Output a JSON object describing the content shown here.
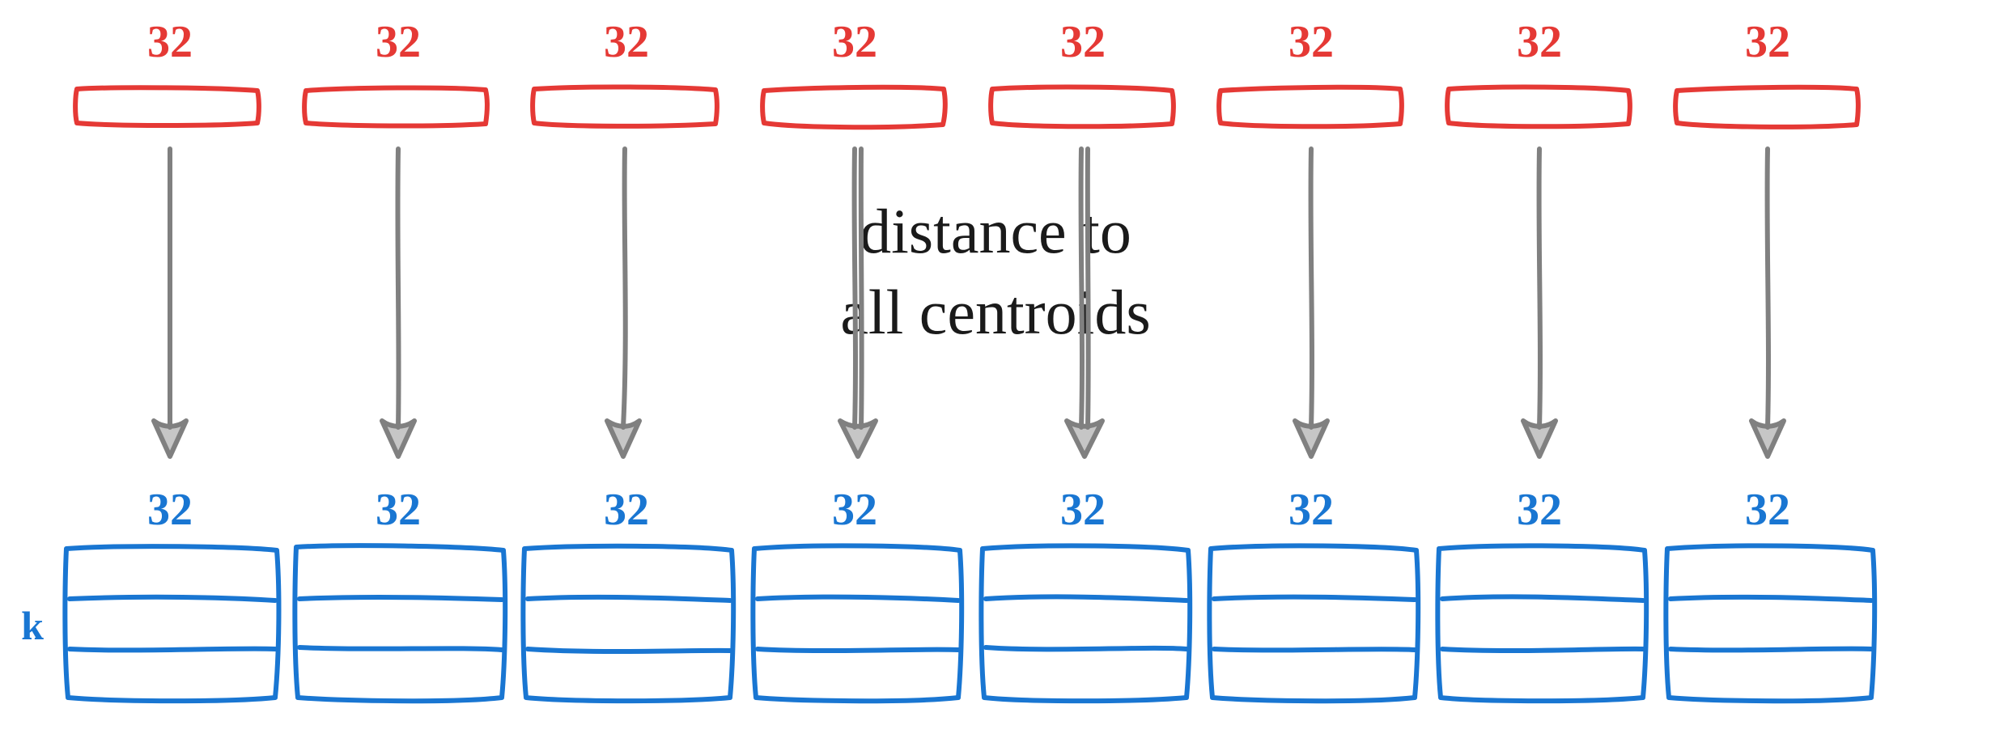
{
  "diagram": {
    "top_labels": [
      "32",
      "32",
      "32",
      "32",
      "32",
      "32",
      "32",
      "32"
    ],
    "bottom_labels": [
      "32",
      "32",
      "32",
      "32",
      "32",
      "32",
      "32",
      "32"
    ],
    "k_label": "k",
    "caption_line1": "distance to",
    "caption_line2": "all centroids"
  },
  "colors": {
    "red": "#e53935",
    "blue": "#1976d2",
    "arrow": "#808080",
    "text": "#1a1a1a"
  },
  "counts": {
    "columns": 8,
    "centroid_rows": 3,
    "subvector_dim": 32
  }
}
